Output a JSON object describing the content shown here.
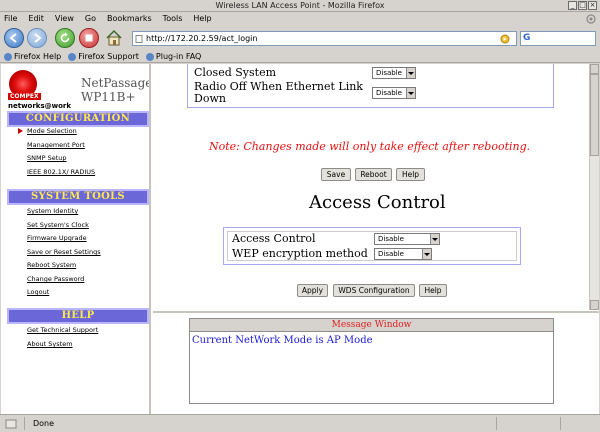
{
  "window": {
    "title": "Wireless LAN Access Point - Mozilla Firefox"
  },
  "menubar": {
    "items": [
      {
        "label": "File"
      },
      {
        "label": "Edit"
      },
      {
        "label": "View"
      },
      {
        "label": "Go"
      },
      {
        "label": "Bookmarks"
      },
      {
        "label": "Tools"
      },
      {
        "label": "Help"
      }
    ]
  },
  "navbar": {
    "url": "http://172.20.2.59/act_login"
  },
  "bookmarks": {
    "items": [
      {
        "label": "Firefox Help"
      },
      {
        "label": "Firefox Support"
      },
      {
        "label": "Plug-in FAQ"
      }
    ]
  },
  "sidebar": {
    "logo_text": "COMPEX",
    "logo_tagline": "networks@work",
    "product_line1": "NetPassage",
    "product_line2": "WP11B+",
    "sections": [
      {
        "title": "CONFIGURATION",
        "links": [
          "Mode Selection",
          "Management Port",
          "SNMP Setup",
          "IEEE 802.1X/ RADIUS"
        ]
      },
      {
        "title": "SYSTEM TOOLS",
        "links": [
          "System Identity",
          "Set System's Clock",
          "Firmware Upgrade",
          "Save or Reset Settings",
          "Reboot System",
          "Change Password",
          "Logout"
        ]
      },
      {
        "title": "HELP",
        "links": [
          "Get Technical Support",
          "About System"
        ]
      }
    ]
  },
  "main": {
    "top_panel": {
      "rows": [
        {
          "label": "Closed System",
          "value": "Disable"
        },
        {
          "label_line1": "Radio Off When Ethernet Link",
          "label_line2": "Down",
          "value": "Disable"
        }
      ]
    },
    "note": "Note: Changes made will only take effect after rebooting.",
    "buttons1": {
      "save": "Save",
      "reboot": "Reboot",
      "help": "Help"
    },
    "access_control": {
      "title": "Access Control",
      "rows": [
        {
          "label": "Access Control",
          "value": "Disable"
        },
        {
          "label": "WEP encryption method",
          "value": "Disable"
        }
      ]
    },
    "buttons2": {
      "apply": "Apply",
      "wds": "WDS Configuration",
      "help": "Help"
    }
  },
  "message_window": {
    "title": "Message Window",
    "message": "Current NetWork Mode is AP Mode"
  },
  "statusbar": {
    "text": "Done"
  }
}
